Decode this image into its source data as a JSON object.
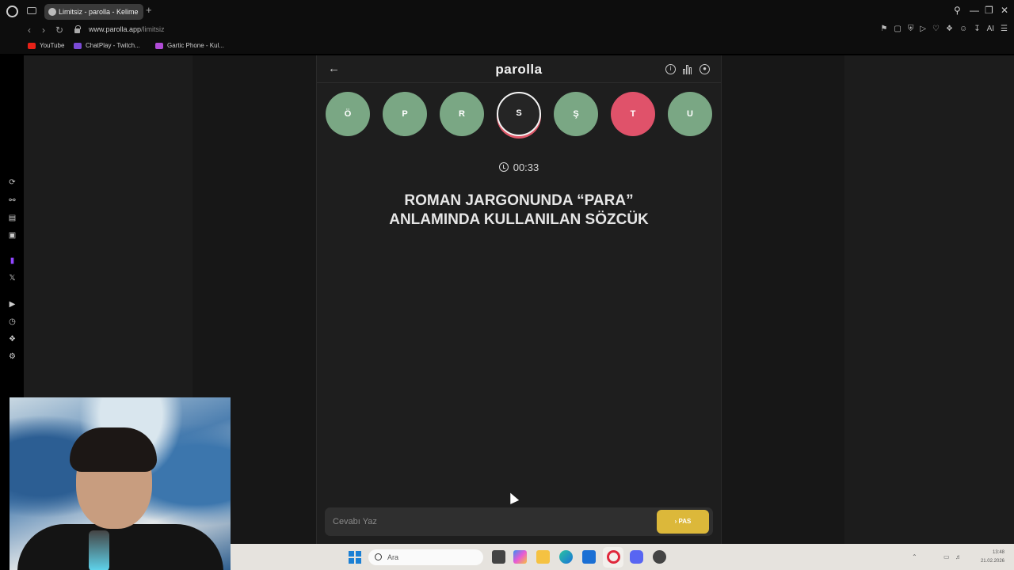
{
  "browser": {
    "tab_title": "Limitsiz - parolla - Kelime",
    "new_tab": "+",
    "url_domain": "www.parolla.app",
    "url_path": "/limitsiz",
    "bookmarks": [
      {
        "label": "YouTube",
        "color": "#e62117"
      },
      {
        "label": "ChatPlay - Twitch...",
        "color": "#7b4bd6"
      },
      {
        "label": "Gartic Phone - Kul...",
        "color": "#b04bd6"
      }
    ],
    "ai_label": "AI"
  },
  "app": {
    "title": "parolla",
    "letters": [
      {
        "char": "Ö",
        "state": "correct"
      },
      {
        "char": "P",
        "state": "correct"
      },
      {
        "char": "R",
        "state": "correct"
      },
      {
        "char": "S",
        "state": "current"
      },
      {
        "char": "Ş",
        "state": "correct"
      },
      {
        "char": "T",
        "state": "wrong"
      },
      {
        "char": "U",
        "state": "correct"
      }
    ],
    "timer": "00:33",
    "question_line1": "ROMAN JARGONUNDA “PARA”",
    "question_line2": "ANLAMINDA KULLANILAN SÖZCÜK",
    "answer_placeholder": "Cevabı Yaz",
    "pass_label": "PAS",
    "colors": {
      "correct": "#7aa784",
      "wrong": "#e0526a",
      "pass": "#dcb83a"
    }
  },
  "taskbar": {
    "search_placeholder": "Ara",
    "time": "13:48",
    "date": "21.02.2026"
  }
}
